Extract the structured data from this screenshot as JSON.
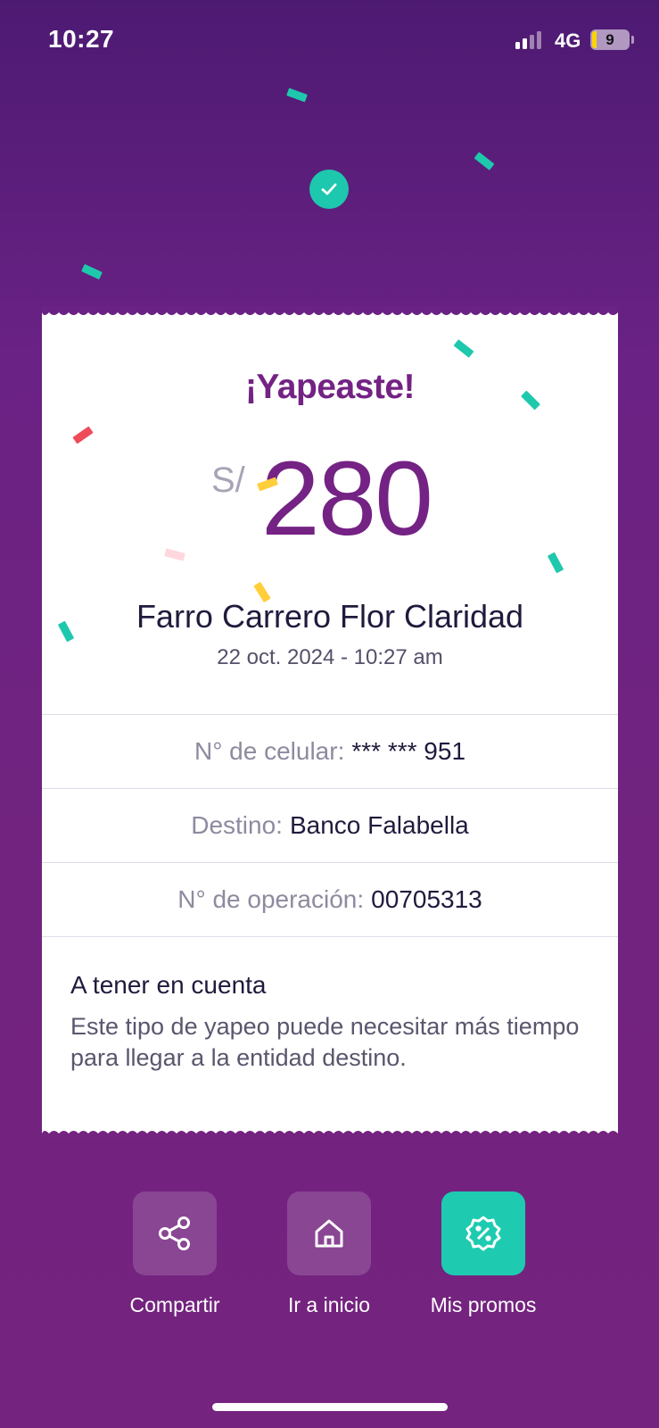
{
  "status_bar": {
    "time": "10:27",
    "network": "4G",
    "battery_level": "9"
  },
  "receipt": {
    "title": "¡Yapeaste!",
    "currency": "S/",
    "amount": "280",
    "recipient": "Farro Carrero Flor Claridad",
    "datetime": "22 oct. 2024 - 10:27 am",
    "details": [
      {
        "label": "N° de celular:",
        "value": "*** *** 951"
      },
      {
        "label": "Destino:",
        "value": "Banco Falabella"
      },
      {
        "label": "N° de operación:",
        "value": "00705313"
      }
    ],
    "note": {
      "title": "A tener en cuenta",
      "body": "Este tipo de yapeo puede necesitar más tiempo para llegar a la entidad destino."
    }
  },
  "actions": [
    {
      "label": "Compartir",
      "icon": "share-icon"
    },
    {
      "label": "Ir a inicio",
      "icon": "home-icon"
    },
    {
      "label": "Mis promos",
      "icon": "promo-badge-icon"
    }
  ],
  "colors": {
    "brand_purple": "#742284",
    "accent_teal": "#1ecbb0",
    "background": "#6a2284"
  }
}
